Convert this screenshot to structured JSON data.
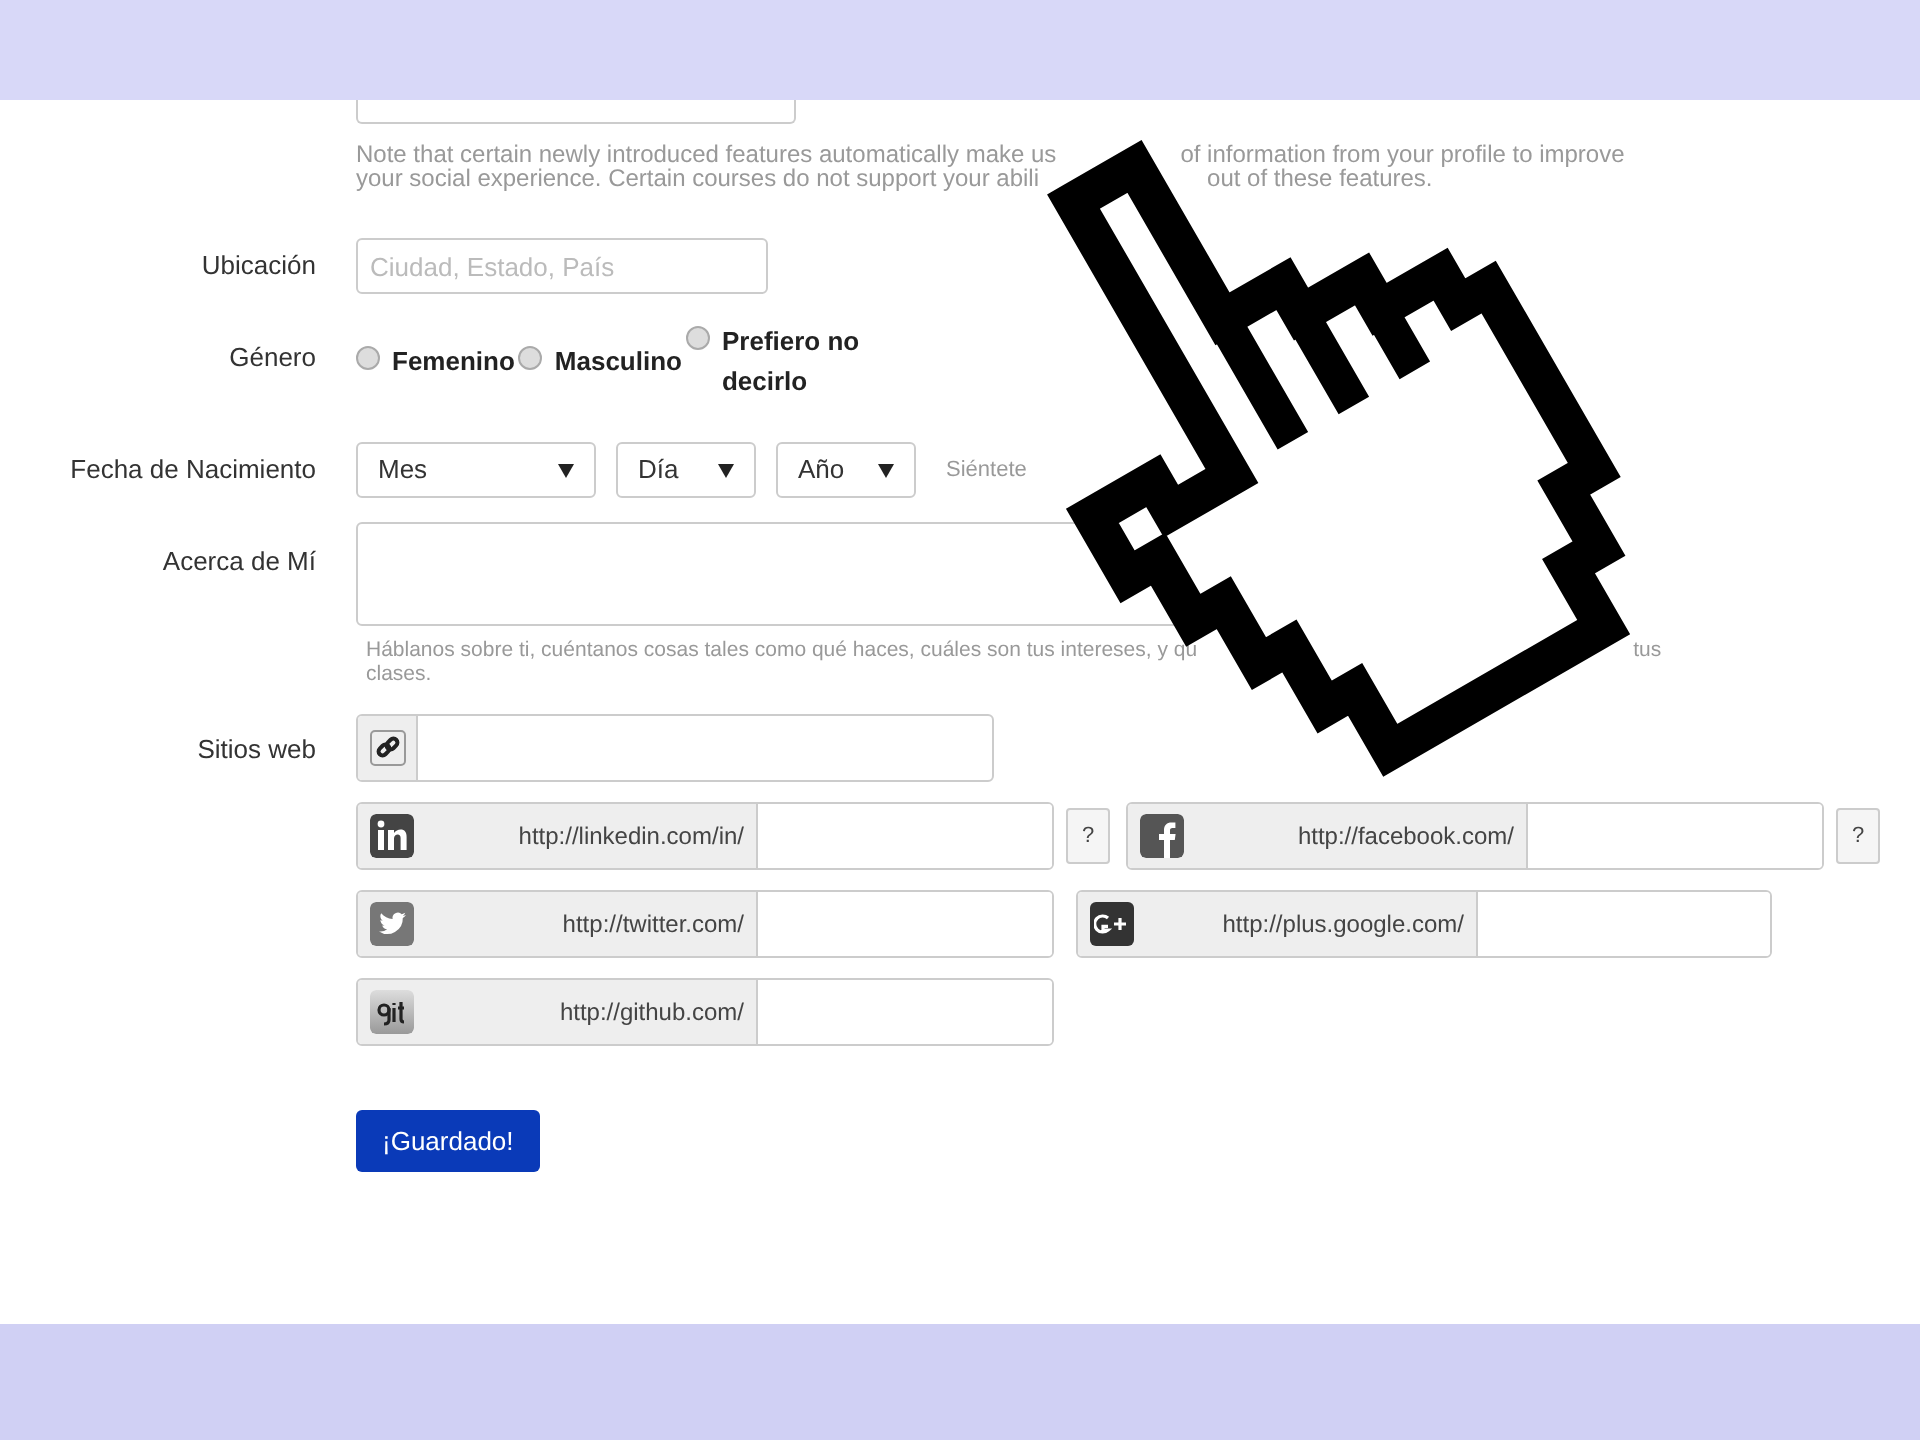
{
  "note_parts": [
    "Note that certain newly introduced features automatically make us",
    "of information from your profile to improve",
    "your social experience. Certain courses do not support your abili",
    "out of these features."
  ],
  "location": {
    "label": "Ubicación",
    "placeholder": "Ciudad, Estado, País"
  },
  "gender": {
    "label": "Género",
    "options": [
      {
        "label": "Femenino",
        "selected": false
      },
      {
        "label": "Masculino",
        "selected": false
      },
      {
        "label": "Prefiero no decirlo",
        "selected": false
      }
    ]
  },
  "birthdate": {
    "label": "Fecha de Nacimiento",
    "selects": [
      "Mes",
      "Día",
      "Año"
    ],
    "hint": "Siéntete"
  },
  "about": {
    "label": "Acerca de Mí",
    "hint_parts": [
      "Háblanos sobre ti, cuéntanos cosas tales como qué haces, cuáles son tus intereses, y qu",
      "tus",
      "clases."
    ]
  },
  "websites": {
    "label": "Sitios web",
    "fields": [
      {
        "kind": "link"
      },
      {
        "kind": "linkedin",
        "prefix": "http://linkedin.com/in/",
        "help": "?"
      },
      {
        "kind": "facebook",
        "prefix": "http://facebook.com/",
        "help": "?"
      },
      {
        "kind": "twitter",
        "prefix": "http://twitter.com/"
      },
      {
        "kind": "google",
        "prefix": "http://plus.google.com/"
      },
      {
        "kind": "github",
        "prefix": "http://github.com/"
      }
    ]
  },
  "save_button": "¡Guardado!"
}
